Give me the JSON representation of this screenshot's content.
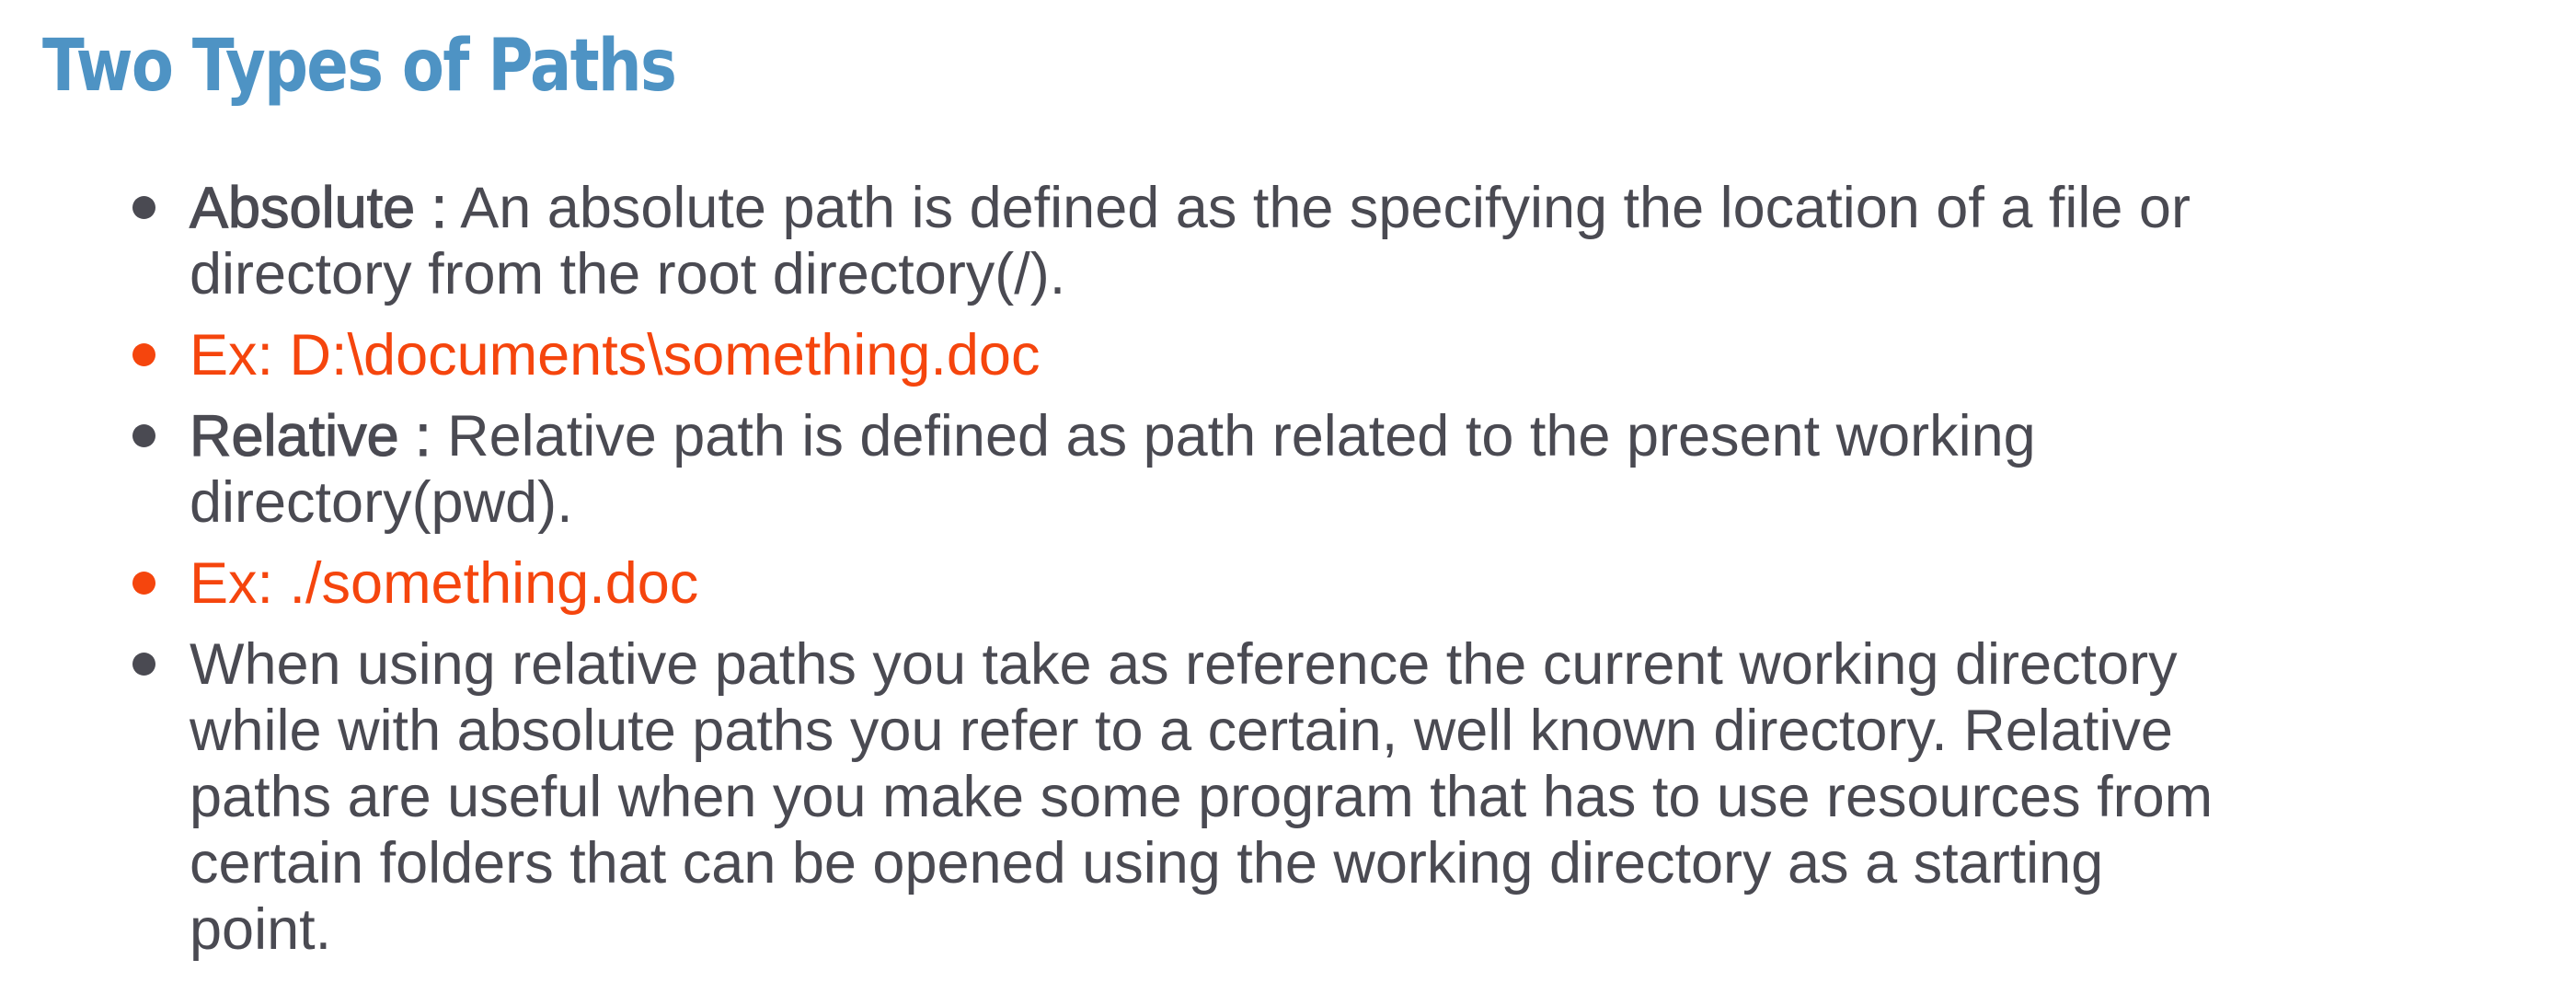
{
  "title": "Two Types of Paths",
  "colors": {
    "title": "#4e93c4",
    "body_text": "#4a4a52",
    "example_text": "#f5450d"
  },
  "bullets": [
    {
      "term": "Absolute :",
      "line1": " An absolute path is defined as the specifying the location of a file or",
      "line2": "directory from the root directory(/)."
    },
    {
      "text": "Ex: D:\\documents\\something.doc"
    },
    {
      "term": "Relative :",
      "line1": " Relative path is defined as path related to the present working",
      "line2": "directory(pwd)."
    },
    {
      "text": "Ex: ./something.doc"
    },
    {
      "lines": [
        "When using relative paths you take as reference the current working directory",
        "while with absolute paths you refer to a certain, well known directory. Relative",
        "paths are useful when you make some program that has to use resources from",
        "certain folders that can be opened using the working directory as a starting",
        "point."
      ]
    }
  ]
}
